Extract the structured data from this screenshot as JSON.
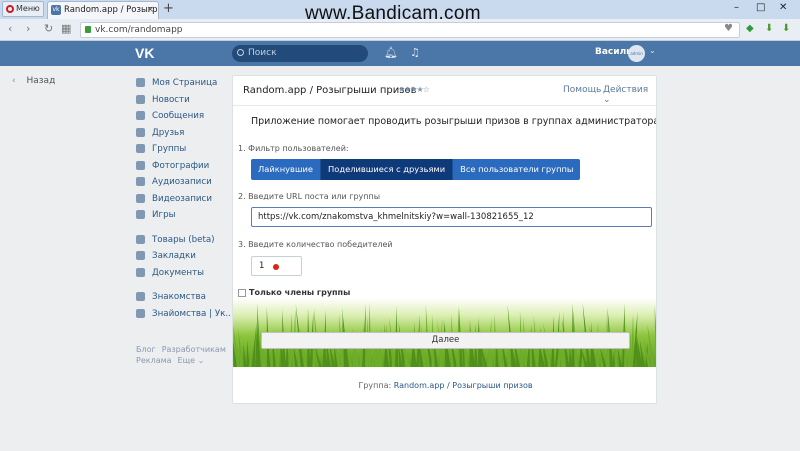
{
  "browser": {
    "menu_label": "Меню",
    "tab_title": "Random.app / Розыгрыши",
    "tab_favicon": "vk-favicon",
    "url": "vk.com/randomapp",
    "watermark": "www.Bandicam.com",
    "win_minimize": "–",
    "win_maximize": "□",
    "win_close": "✕"
  },
  "vk_header": {
    "logo": "VK",
    "search_placeholder": "Поиск",
    "user_name": "Василий",
    "avatar_text": "admin"
  },
  "sidebar": {
    "back_label": "Назад",
    "items": [
      {
        "label": "Моя Страница",
        "icon": "home-icon"
      },
      {
        "label": "Новости",
        "icon": "news-icon"
      },
      {
        "label": "Сообщения",
        "icon": "messages-icon"
      },
      {
        "label": "Друзья",
        "icon": "friends-icon"
      },
      {
        "label": "Группы",
        "icon": "groups-icon"
      },
      {
        "label": "Фотографии",
        "icon": "photos-icon"
      },
      {
        "label": "Аудиозаписи",
        "icon": "music-icon"
      },
      {
        "label": "Видеозаписи",
        "icon": "video-icon"
      },
      {
        "label": "Игры",
        "icon": "games-icon"
      }
    ],
    "items2": [
      {
        "label": "Товары (beta)",
        "icon": "goods-icon"
      },
      {
        "label": "Закладки",
        "icon": "bookmarks-icon"
      },
      {
        "label": "Документы",
        "icon": "documents-icon"
      }
    ],
    "items3": [
      {
        "label": "Знакомства",
        "icon": "dating-icon"
      },
      {
        "label": "Знайомства | Ук..",
        "icon": "dating-icon"
      }
    ],
    "footer": {
      "blog": "Блог",
      "dev": "Разработчикам",
      "ads": "Реклама",
      "more": "Еще ⌄"
    }
  },
  "app": {
    "title": "Random.app / Розыгрыши призов",
    "stars": "★★★★☆",
    "help": "Помощь",
    "actions": "Действия ⌄",
    "intro": "Приложение помогает проводить розыгрыши призов в группах администраторам групп.",
    "step1": "1. Фильтр пользователей:",
    "filters": [
      "Лайкнувшие",
      "Поделившиеся с друзьями",
      "Все пользователи группы"
    ],
    "step2": "2. Введите URL поста или группы",
    "url_value": "https://vk.com/znakomstva_khmelnitskiy?w=wall-130821655_12",
    "step3": "3. Введите количество победителей",
    "count_value": "1",
    "members_only": "Только члены группы",
    "next_button": "Далее",
    "footer_prefix": "Группа:",
    "footer_link": "Random.app / Розыгрыши призов"
  }
}
